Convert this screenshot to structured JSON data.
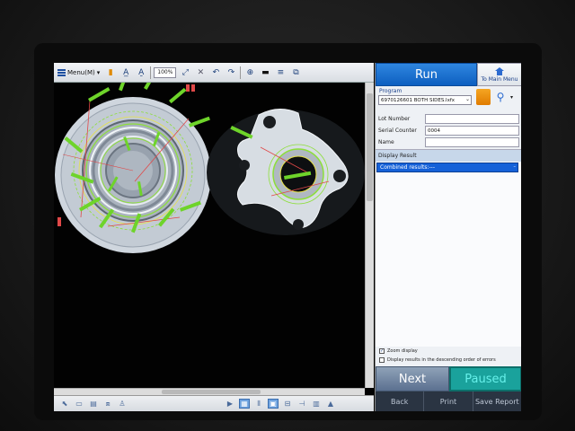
{
  "toolbar": {
    "menu_label": "Menu(M)",
    "zoom": "100%"
  },
  "right_panel": {
    "run_label": "Run",
    "main_menu_label": "To Main Menu",
    "program_label": "Program",
    "program_value": "6970126601 BOTH SIDES.lxfx",
    "fields": [
      {
        "label": "Lot Number",
        "value": ""
      },
      {
        "label": "Serial Counter",
        "value": "0004"
      },
      {
        "label": "Name",
        "value": ""
      }
    ],
    "display_result_label": "Display Result",
    "combined_result": "Combined results:---",
    "checkboxes": [
      {
        "label": "Zoom display",
        "checked": true
      },
      {
        "label": "Display results in the descending order of errors",
        "checked": false
      }
    ],
    "next_label": "Next",
    "paused_label": "Paused",
    "back_label": "Back",
    "print_label": "Print",
    "save_report_label": "Save Report"
  },
  "colors": {
    "run_blue": "#1a6fd0",
    "paused_teal": "#1aa29c",
    "combined_blue": "#1561d8"
  }
}
